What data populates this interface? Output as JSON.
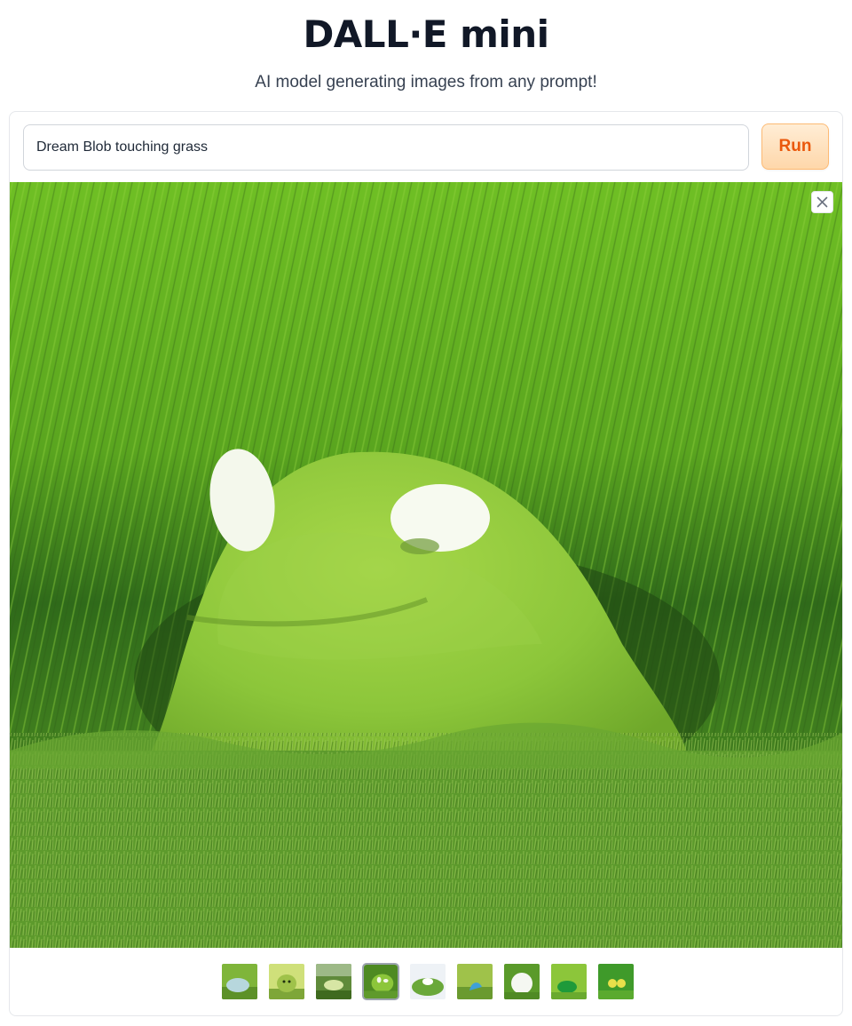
{
  "app": {
    "title": "DALL·E mini",
    "subtitle": "AI model generating images from any prompt!"
  },
  "prompt": {
    "value": "Dream Blob touching grass"
  },
  "run_button": {
    "label": "Run"
  },
  "gallery": {
    "selected_index": 3,
    "thumbnail_count": 9,
    "close_icon": "close-icon"
  },
  "colors": {
    "accent": "#ea580c",
    "run_bg": "#fed7aa",
    "grass": "#5aa21e"
  }
}
